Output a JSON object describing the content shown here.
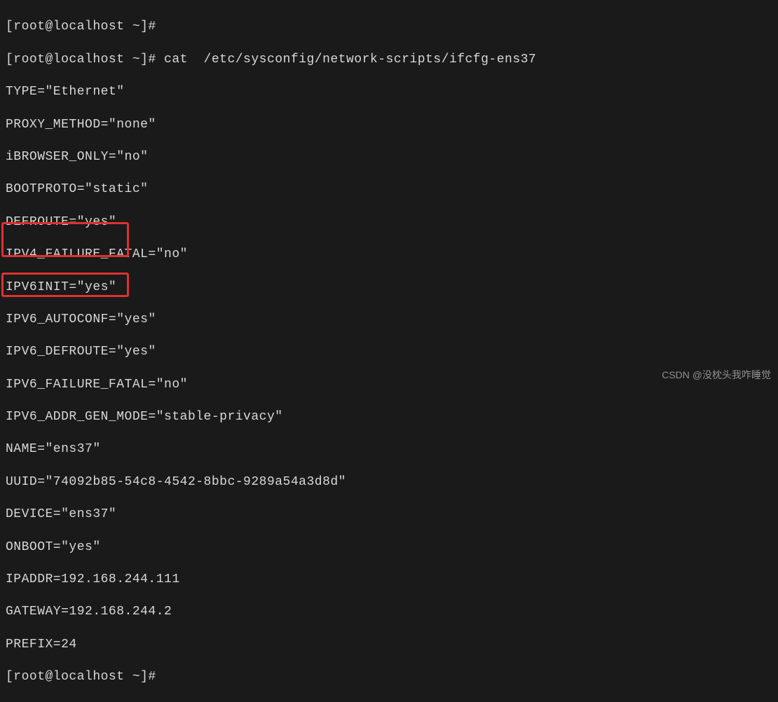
{
  "prompts": {
    "line0": "[root@localhost ~]#",
    "line1": "[root@localhost ~]# cat  /etc/sysconfig/network-scripts/ifcfg-ens37",
    "last": "[root@localhost ~]#"
  },
  "config": {
    "type": "TYPE=\"Ethernet\"",
    "proxy_method": "PROXY_METHOD=\"none\"",
    "browser_only": "iBROWSER_ONLY=\"no\"",
    "bootproto": "BOOTPROTO=\"static\"",
    "defroute": "DEFROUTE=\"yes\"",
    "ipv4_failure_fatal": "IPV4_FAILURE_FATAL=\"no\"",
    "ipv6init": "IPV6INIT=\"yes\"",
    "ipv6_autoconf": "IPV6_AUTOCONF=\"yes\"",
    "ipv6_defroute": "IPV6_DEFROUTE=\"yes\"",
    "ipv6_failure_fatal": "IPV6_FAILURE_FATAL=\"no\"",
    "ipv6_addr_gen_mode": "IPV6_ADDR_GEN_MODE=\"stable-privacy\"",
    "name": "NAME=\"ens37\"",
    "uuid": "UUID=\"74092b85-54c8-4542-8bbc-9289a54a3d8d\"",
    "device": "DEVICE=\"ens37\"",
    "onboot": "ONBOOT=\"yes\"",
    "ipaddr": "IPADDR=192.168.244.111",
    "gateway": "GATEWAY=192.168.244.2",
    "prefix": "PREFIX=24"
  },
  "watermark": "CSDN @没枕头我咋睡觉"
}
